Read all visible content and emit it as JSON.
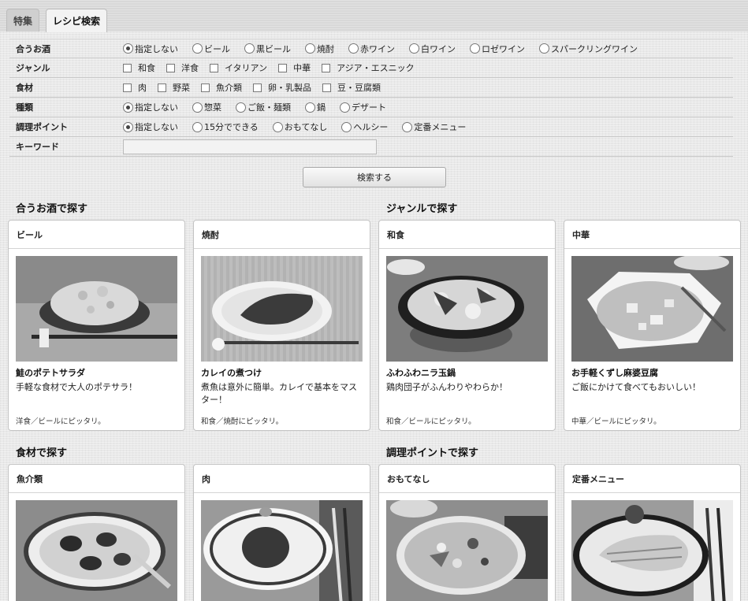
{
  "tabs": [
    {
      "label": "特集"
    },
    {
      "label": "レシピ検索"
    }
  ],
  "filters": {
    "alcohol": {
      "label": "合うお酒",
      "options": [
        "指定しない",
        "ビール",
        "黒ビール",
        "焼酎",
        "赤ワイン",
        "白ワイン",
        "ロゼワイン",
        "スパークリングワイン"
      ],
      "selected": "指定しない"
    },
    "genre": {
      "label": "ジャンル",
      "options": [
        "和食",
        "洋食",
        "イタリアン",
        "中華",
        "アジア・エスニック"
      ]
    },
    "ingredient": {
      "label": "食材",
      "options": [
        "肉",
        "野菜",
        "魚介類",
        "卵・乳製品",
        "豆・豆腐類"
      ]
    },
    "type": {
      "label": "種類",
      "options": [
        "指定しない",
        "惣菜",
        "ご飯・麺類",
        "鍋",
        "デザート"
      ],
      "selected": "指定しない"
    },
    "point": {
      "label": "調理ポイント",
      "options": [
        "指定しない",
        "15分でできる",
        "おもてなし",
        "ヘルシー",
        "定番メニュー"
      ],
      "selected": "指定しない"
    },
    "keyword": {
      "label": "キーワード",
      "value": "",
      "placeholder": ""
    },
    "search_label": "検索する"
  },
  "sections": {
    "alcohol": {
      "title": "合うお酒で探す"
    },
    "genre": {
      "title": "ジャンルで探す"
    },
    "ingredient": {
      "title": "食材で探す"
    },
    "point": {
      "title": "調理ポイントで探す"
    }
  },
  "cards": [
    {
      "head": "ビール",
      "title": "鮭のポテトサラダ",
      "desc": "手軽な食材で大人のポテサラ！",
      "meta": "洋食／ビールにピッタリ。"
    },
    {
      "head": "焼酎",
      "title": "カレイの煮つけ",
      "desc": "煮魚は意外に簡単。カレイで基本をマスター！",
      "meta": "和食／焼酎にピッタリ。"
    },
    {
      "head": "和食",
      "title": "ふわふわニラ玉鍋",
      "desc": "鶏肉団子がふんわりやわらか！",
      "meta": "和食／ビールにピッタリ。"
    },
    {
      "head": "中華",
      "title": "お手軽くずし麻婆豆腐",
      "desc": "ご飯にかけて食べてもおいしい！",
      "meta": "中華／ビールにピッタリ。"
    },
    {
      "head": "魚介類"
    },
    {
      "head": "肉"
    },
    {
      "head": "おもてなし"
    },
    {
      "head": "定番メニュー"
    }
  ]
}
